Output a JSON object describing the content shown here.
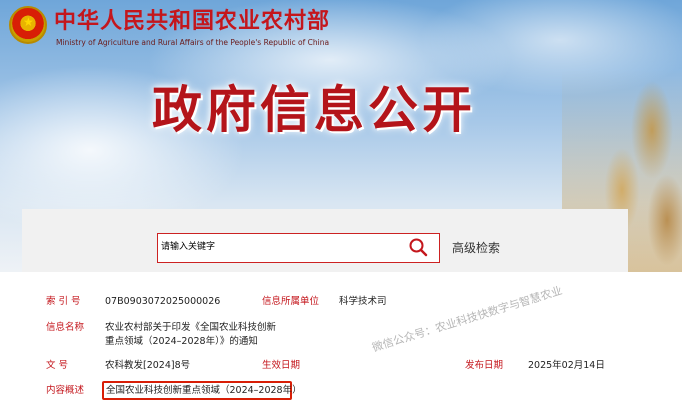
{
  "header": {
    "ministry_cn": "中华人民共和国农业农村部",
    "ministry_en": "Ministry of Agriculture and Rural Affairs of the People's Republic of China",
    "emblem_icon": "national-emblem-icon"
  },
  "hero": {
    "title": "政府信息公开"
  },
  "search": {
    "placeholder": "请输入关键字",
    "search_icon": "search-icon",
    "advanced_label": "高级检索"
  },
  "info": {
    "index_label": "索 引 号",
    "index_value": "07B0903072025000026",
    "dept_label": "信息所属单位",
    "dept_value": "科学技术司",
    "name_label": "信息名称",
    "name_value_line1": "农业农村部关于印发《全国农业科技创新",
    "name_value_line2": "重点领域（2024–2028年）》的通知",
    "doc_label": "文 号",
    "doc_value": "农科教发[2024]8号",
    "effective_label": "生效日期",
    "effective_value": "",
    "issued_label": "发布日期",
    "issued_value": "2025年02月14日",
    "summary_label": "内容概述",
    "summary_value": "全国农业科技创新重点领域（2024–2028年）"
  },
  "watermark": "微信公众号：农业科技快数字与智慧农业",
  "colors": {
    "brand_red": "#c4161c",
    "highlight_red": "#d81e06"
  }
}
